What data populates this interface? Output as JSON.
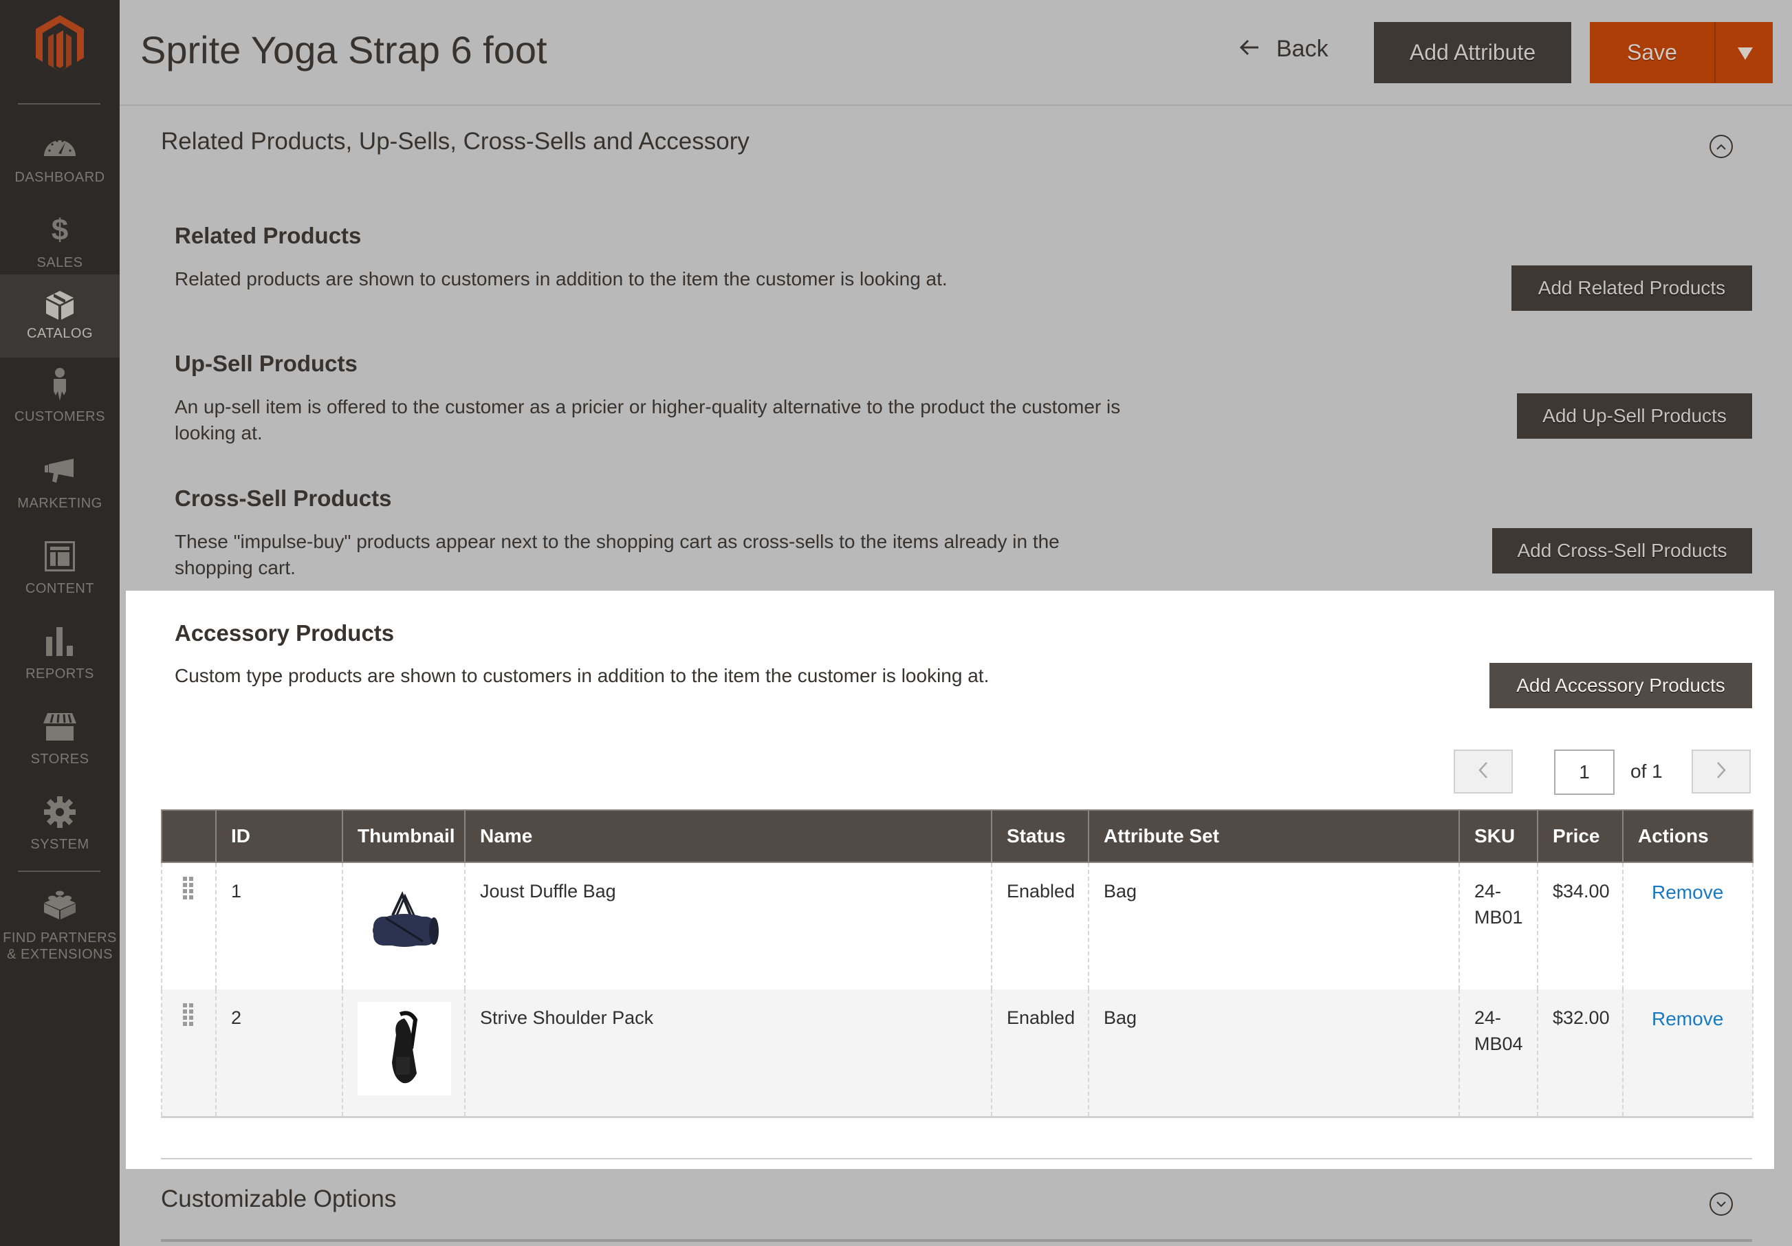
{
  "sidebar": {
    "logo": "magento-logo",
    "items": [
      {
        "label": "DASHBOARD",
        "icon": "dashboard-icon"
      },
      {
        "label": "SALES",
        "icon": "dollar-icon"
      },
      {
        "label": "CATALOG",
        "icon": "box-icon",
        "active": true
      },
      {
        "label": "CUSTOMERS",
        "icon": "person-icon"
      },
      {
        "label": "MARKETING",
        "icon": "megaphone-icon"
      },
      {
        "label": "CONTENT",
        "icon": "layout-icon"
      },
      {
        "label": "REPORTS",
        "icon": "bar-chart-icon"
      },
      {
        "label": "STORES",
        "icon": "storefront-icon"
      },
      {
        "label": "SYSTEM",
        "icon": "gear-icon"
      },
      {
        "label_line1": "FIND PARTNERS",
        "label_line2": "& EXTENSIONS",
        "icon": "lego-block-icon"
      }
    ]
  },
  "header": {
    "title": "Sprite Yoga Strap 6 foot",
    "back_label": "Back",
    "add_attribute_label": "Add Attribute",
    "save_label": "Save"
  },
  "section": {
    "title": "Related Products, Up-Sells, Cross-Sells and Accessory",
    "groups": [
      {
        "title": "Related Products",
        "description": "Related products are shown to customers in addition to the item the customer is looking at.",
        "button": "Add Related Products"
      },
      {
        "title": "Up-Sell Products",
        "description": "An up-sell item is offered to the customer as a pricier or higher-quality alternative to the product the customer is looking at.",
        "button": "Add Up-Sell Products"
      },
      {
        "title": "Cross-Sell Products",
        "description": "These \"impulse-buy\" products appear next to the shopping cart as cross-sells to the items already in the shopping cart.",
        "button": "Add Cross-Sell Products"
      },
      {
        "title": "Accessory Products",
        "description": "Custom type products are shown to customers in addition to the item the customer is looking at.",
        "button": "Add Accessory Products"
      }
    ]
  },
  "pager": {
    "current_page": "1",
    "of_label": "of 1"
  },
  "grid": {
    "columns": [
      "",
      "ID",
      "Thumbnail",
      "Name",
      "Status",
      "Attribute Set",
      "SKU",
      "Price",
      "Actions"
    ],
    "rows": [
      {
        "id": "1",
        "thumbnail": "duffle-bag-image",
        "name": "Joust Duffle Bag",
        "status": "Enabled",
        "attribute_set": "Bag",
        "sku": "24-MB01",
        "price": "$34.00",
        "action": "Remove"
      },
      {
        "id": "2",
        "thumbnail": "shoulder-pack-image",
        "name": "Strive Shoulder Pack",
        "status": "Enabled",
        "attribute_set": "Bag",
        "sku": "24-MB04",
        "price": "$32.00",
        "action": "Remove"
      }
    ]
  },
  "next_section": {
    "title": "Customizable Options"
  },
  "colors": {
    "sidebar_bg": "#2d2926",
    "accent_save": "#ad3e08",
    "button_dark": "#514a45",
    "link": "#1979c3",
    "overlay_bg": "#b9b9b9"
  }
}
